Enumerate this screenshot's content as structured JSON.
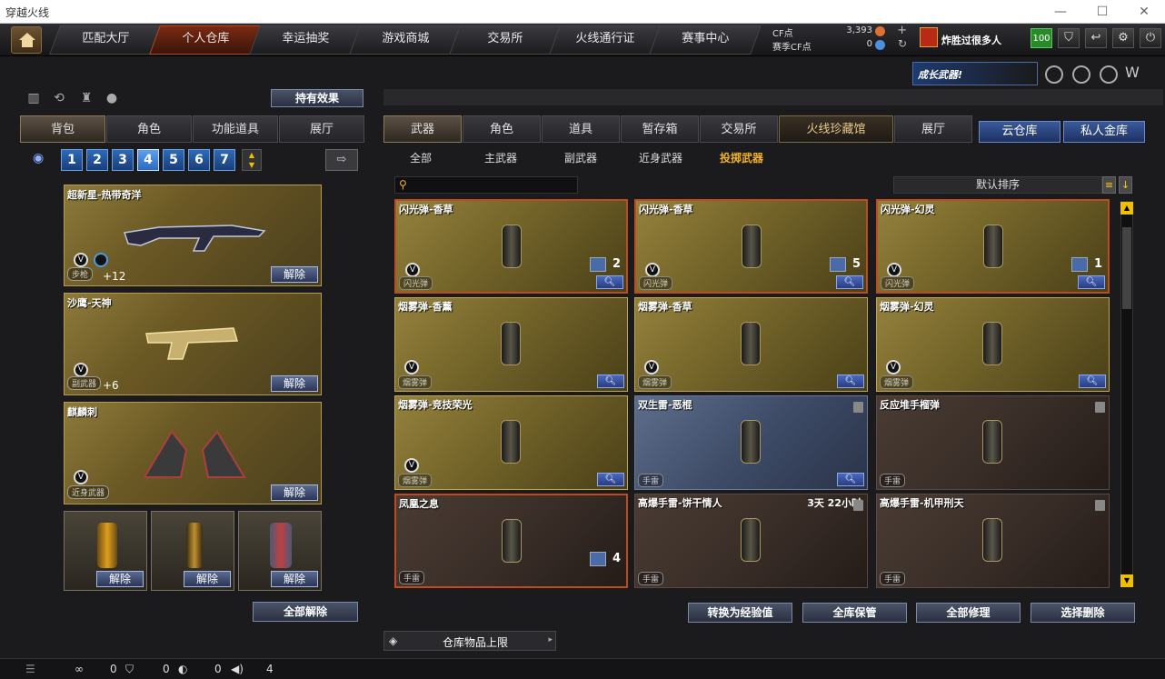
{
  "window": {
    "title": "穿越火线"
  },
  "nav": {
    "tabs": [
      "匹配大厅",
      "个人仓库",
      "幸运抽奖",
      "游戏商城",
      "交易所",
      "火线通行证",
      "赛事中心"
    ],
    "active": 1
  },
  "account": {
    "cf_label": "CF点",
    "cf_value": "3,393",
    "match_cf_label": "赛季CF点",
    "match_cf_value": "0",
    "username": "炸胜过很多人",
    "level": "100"
  },
  "banner": {
    "growth_weapon": "成长武器!"
  },
  "left": {
    "effects_button": "持有效果",
    "tabs": [
      "背包",
      "角色",
      "功能道具",
      "展厅"
    ],
    "active_tab": 0,
    "slot_numbers": [
      "1",
      "2",
      "3",
      "4",
      "5",
      "6",
      "7"
    ],
    "selected_slot": 3,
    "weapons": [
      {
        "name": "超新星-热带奇洋",
        "type": "步枪",
        "plus": "+12",
        "release": "解除"
      },
      {
        "name": "沙鹰-天神",
        "type": "副武器",
        "plus": "+6",
        "release": "解除"
      },
      {
        "name": "麒麟刺",
        "type": "近身武器",
        "plus": "",
        "release": "解除"
      }
    ],
    "slots": [
      {
        "release": "解除"
      },
      {
        "release": "解除"
      },
      {
        "release": "解除"
      }
    ],
    "release_all": "全部解除"
  },
  "right": {
    "tabs": [
      "武器",
      "角色",
      "道具",
      "暂存箱",
      "交易所",
      "火线珍藏馆",
      "展厅"
    ],
    "active_tab": 0,
    "side_tabs": [
      "云仓库",
      "私人金库"
    ],
    "categories": [
      "全部",
      "主武器",
      "副武器",
      "近身武器",
      "投掷武器"
    ],
    "selected_category": 4,
    "sort_label": "默认排序",
    "items": [
      {
        "name": "闪光弹-香草",
        "type": "闪光弹",
        "count": "2",
        "style": "goldsel"
      },
      {
        "name": "闪光弹-香草",
        "type": "闪光弹",
        "count": "5",
        "style": "goldsel"
      },
      {
        "name": "闪光弹-幻灵",
        "type": "闪光弹",
        "count": "1",
        "style": "goldsel"
      },
      {
        "name": "烟雾弹-香薰",
        "type": "烟雾弹",
        "count": "",
        "style": "gold"
      },
      {
        "name": "烟雾弹-香草",
        "type": "烟雾弹",
        "count": "",
        "style": "gold"
      },
      {
        "name": "烟雾弹-幻灵",
        "type": "烟雾弹",
        "count": "",
        "style": "gold"
      },
      {
        "name": "烟雾弹-竞技荣光",
        "type": "烟雾弹",
        "count": "",
        "style": "gold"
      },
      {
        "name": "双生雷-恶棍",
        "type": "手雷",
        "count": "",
        "style": "blue"
      },
      {
        "name": "反应堆手榴弹",
        "type": "手雷",
        "count": "",
        "style": "brown"
      },
      {
        "name": "凤凰之息",
        "type": "手雷",
        "count": "4",
        "style": "brownsel"
      },
      {
        "name": "高爆手雷-饼干情人",
        "type": "手雷",
        "count": "",
        "time": "3天 22小时",
        "style": "brown"
      },
      {
        "name": "高爆手雷-机甲刑天",
        "type": "手雷",
        "count": "",
        "style": "brown"
      }
    ],
    "actions": [
      "转换为经验值",
      "全库保管",
      "全部修理",
      "选择删除"
    ]
  },
  "storage_limit": "仓库物品上限",
  "status": {
    "a": "0",
    "b": "0",
    "c": "0",
    "d": "4"
  }
}
